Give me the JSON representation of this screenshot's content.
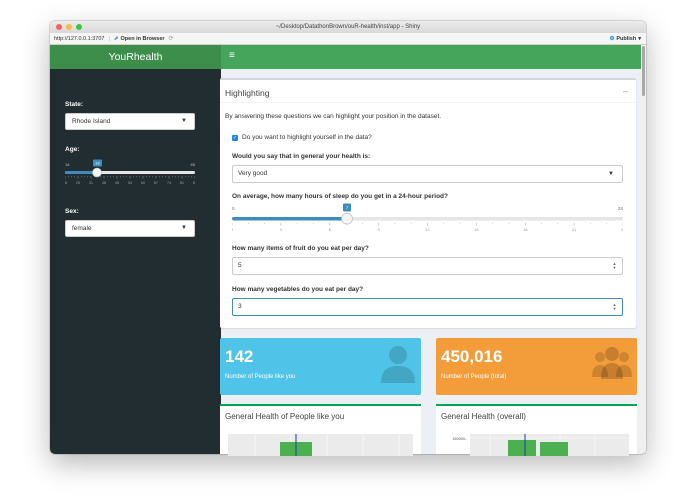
{
  "window": {
    "title": "~/Desktop/DatathonBrown/ouR-health/inst/app - Shiny",
    "url": "http://127.0.0.1:3707",
    "open_in_browser": "Open in Browser",
    "publish": "Publish"
  },
  "app": {
    "brand": "YouRhealth"
  },
  "sidebar": {
    "state_label": "State:",
    "state_value": "Rhode Island",
    "age_label": "Age:",
    "age_min": "18",
    "age_max": "85",
    "age_value": "33",
    "age_ticks": [
      "18",
      "25",
      "31",
      "38",
      "45",
      "53",
      "60",
      "67",
      "74",
      "81",
      "85"
    ],
    "sex_label": "Sex:",
    "sex_value": "female"
  },
  "highlight": {
    "title": "Highlighting",
    "collapse": "–",
    "intro": "By answering these questions we can highlight your position in the dataset.",
    "checkbox_label": "Do you want to highlight yourself in the data?",
    "health_label": "Would you say that in general your health is:",
    "health_value": "Very good",
    "sleep_label": "On average, how many hours of sleep do you get in a 24-hour period?",
    "sleep_min": "0",
    "sleep_max": "24",
    "sleep_value": "7",
    "sleep_ticks": [
      "0",
      "3",
      "6",
      "9",
      "12",
      "15",
      "18",
      "21",
      "24"
    ],
    "fruit_label": "How many items of fruit do you eat per day?",
    "fruit_value": "5",
    "veg_label": "How many vegetables do you eat per day?",
    "veg_value": "3"
  },
  "stats": {
    "like_you_count": "142",
    "like_you_label": "Number of People like you",
    "total_count": "450,016",
    "total_label": "Number of People (total)"
  },
  "plots": {
    "left_title": "General Health of People like you",
    "right_title": "General Health (overall)",
    "right_axis_tick": "150000-"
  },
  "colors": {
    "header": "#45a55a",
    "logo": "#3e8e4b",
    "sidebar": "#222d32",
    "aqua": "#4fc3e8",
    "orange": "#f39c3a",
    "slider": "#3c8dbc"
  }
}
